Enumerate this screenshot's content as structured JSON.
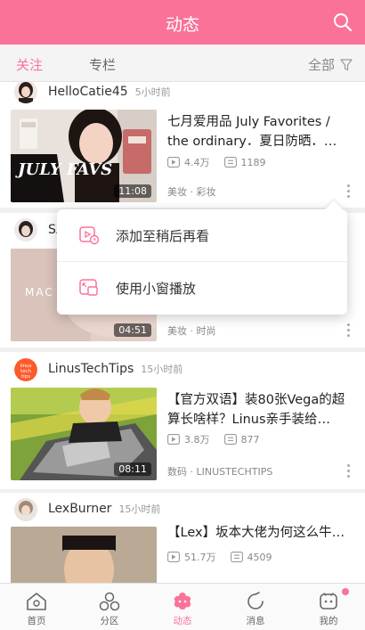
{
  "header": {
    "title": "动态"
  },
  "subtabs": {
    "follow": "关注",
    "column": "专栏",
    "filter_label": "全部"
  },
  "cards": [
    {
      "user": "HelloCatie45",
      "time": "5小时前",
      "title": "七月爱用品 July Favorites / the ordinary．夏日防晒．…",
      "thumb_text": "JULY FAVS",
      "duration": "11:08",
      "plays": "4.4万",
      "comments": "1189",
      "tags": "美妆 · 彩妆"
    },
    {
      "user": "SA",
      "time": "",
      "title": "",
      "thumb_text": "MAC",
      "duration": "04:51",
      "plays": "",
      "comments": "",
      "tags": "美妆 · 时尚"
    },
    {
      "user": "LinusTechTips",
      "avatar_text": "linus tech tips",
      "time": "15小时前",
      "title": "【官方双语】装80张Vega的超算长啥样？Linus亲手装给…",
      "duration": "08:11",
      "plays": "3.8万",
      "comments": "877",
      "tags": "数码 · LINUSTECHTIPS"
    },
    {
      "user": "LexBurner",
      "time": "15小时前",
      "title": "【Lex】坂本大佬为何这么牛…",
      "plays": "51.7万",
      "comments": "4509"
    }
  ],
  "popup": {
    "watch_later": "添加至稍后再看",
    "mini_window": "使用小窗播放"
  },
  "nav": [
    {
      "label": "首页"
    },
    {
      "label": "分区"
    },
    {
      "label": "动态"
    },
    {
      "label": "消息"
    },
    {
      "label": "我的"
    }
  ],
  "colors": {
    "accent": "#fb7299"
  }
}
